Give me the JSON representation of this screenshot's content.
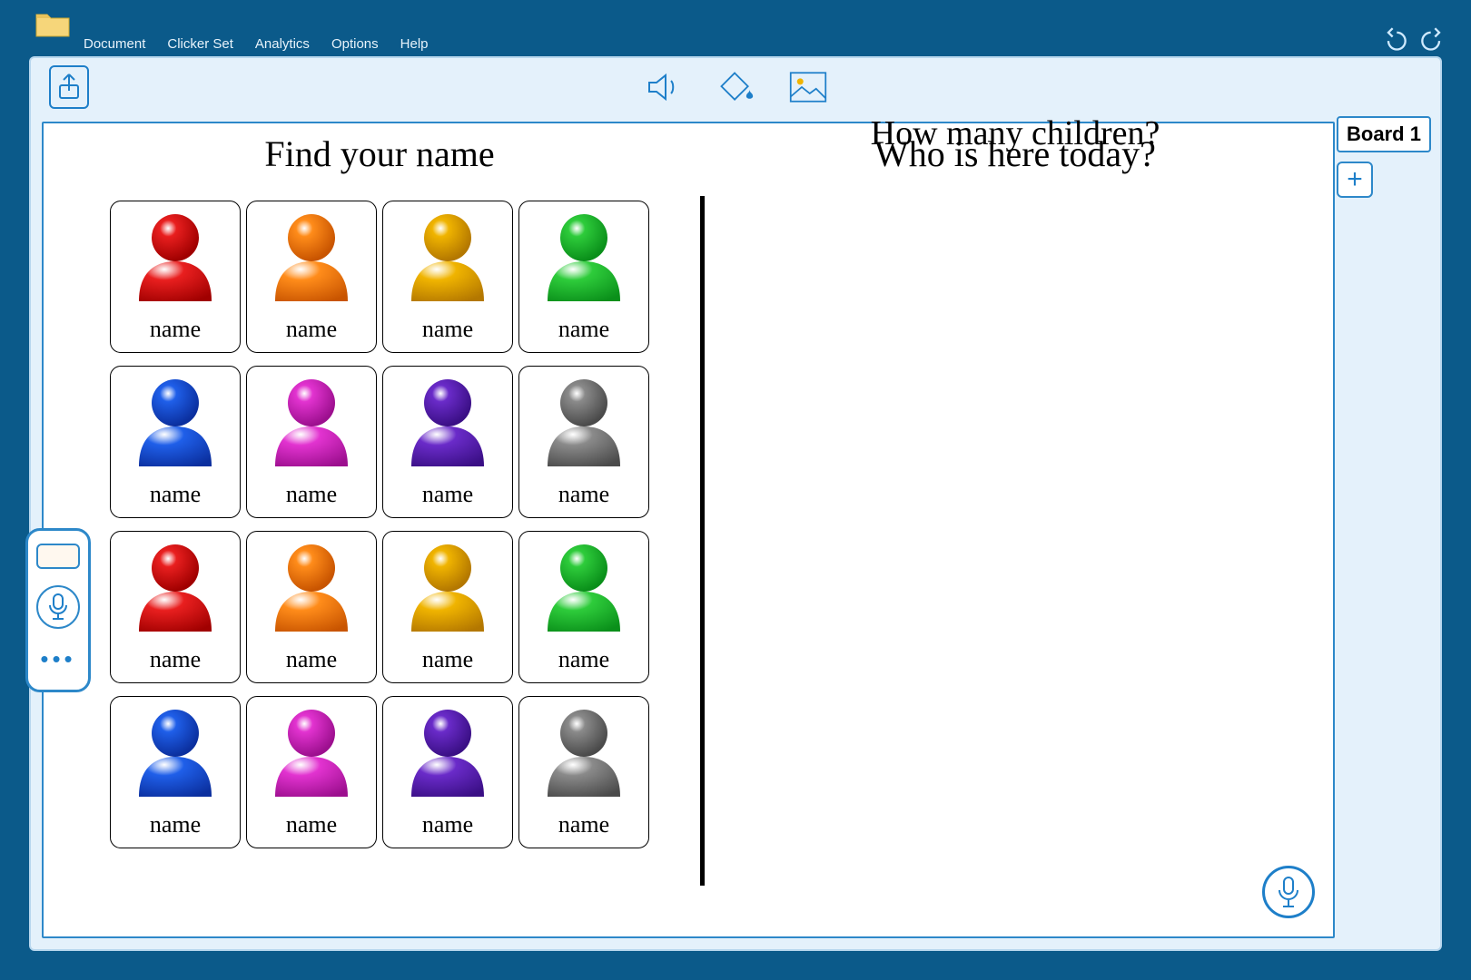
{
  "menu": {
    "items": [
      "Document",
      "Clicker Set",
      "Analytics",
      "Options",
      "Help"
    ]
  },
  "board_tab": "Board 1",
  "left_heading": "Find your name",
  "right_heading": "Who is here today?",
  "bottom_question": "How many children?",
  "cells": [
    {
      "label": "name",
      "c1": "#e91f1f",
      "c2": "#a00000"
    },
    {
      "label": "name",
      "c1": "#ff8c1a",
      "c2": "#c85400"
    },
    {
      "label": "name",
      "c1": "#f0b400",
      "c2": "#b37700"
    },
    {
      "label": "name",
      "c1": "#2ecc3b",
      "c2": "#0a8f1a"
    },
    {
      "label": "name",
      "c1": "#1f5fe9",
      "c2": "#0b2f9e"
    },
    {
      "label": "name",
      "c1": "#e233d0",
      "c2": "#9c0f8e"
    },
    {
      "label": "name",
      "c1": "#6a2bc9",
      "c2": "#3a0f85"
    },
    {
      "label": "name",
      "c1": "#8a8a8a",
      "c2": "#4a4a4a"
    },
    {
      "label": "name",
      "c1": "#e91f1f",
      "c2": "#a00000"
    },
    {
      "label": "name",
      "c1": "#ff8c1a",
      "c2": "#c85400"
    },
    {
      "label": "name",
      "c1": "#f0b400",
      "c2": "#b37700"
    },
    {
      "label": "name",
      "c1": "#2ecc3b",
      "c2": "#0a8f1a"
    },
    {
      "label": "name",
      "c1": "#1f5fe9",
      "c2": "#0b2f9e"
    },
    {
      "label": "name",
      "c1": "#e233d0",
      "c2": "#9c0f8e"
    },
    {
      "label": "name",
      "c1": "#6a2bc9",
      "c2": "#3a0f85"
    },
    {
      "label": "name",
      "c1": "#8a8a8a",
      "c2": "#4a4a4a"
    }
  ]
}
